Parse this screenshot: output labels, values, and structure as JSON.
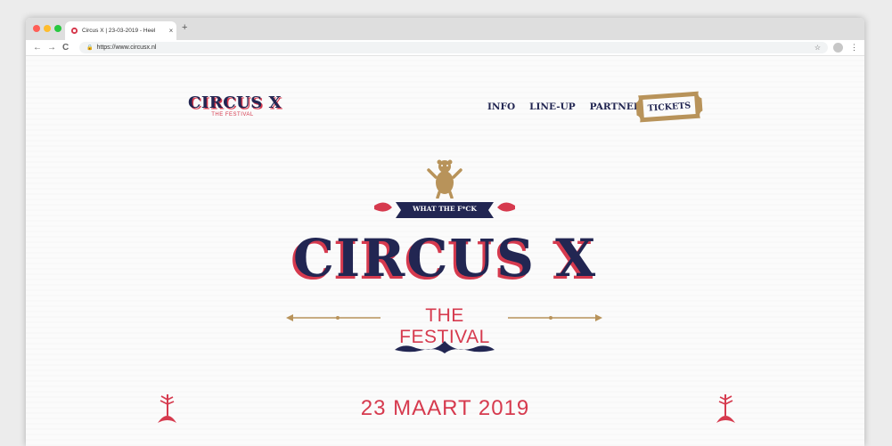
{
  "browser": {
    "tab_title": "Circus X | 23-03-2019 - Heel",
    "new_tab_label": "+",
    "close_label": "×",
    "url": "https://www.circusx.nl",
    "back_label": "←",
    "forward_label": "→",
    "reload_label": "C",
    "bookmark_label": "☆",
    "menu_label": "⋮"
  },
  "header": {
    "logo_text": "CIRCUS X",
    "logo_sub": "THE FESTIVAL",
    "nav": [
      "INFO",
      "LINE-UP",
      "PARTNERS"
    ],
    "tickets_label": "TICKETS"
  },
  "hero": {
    "banner_text": "WHAT THE F*CK",
    "title": "CIRCUS X",
    "subtitle": "THE FESTIVAL",
    "date": "23 MAART 2019"
  },
  "colors": {
    "navy": "#222652",
    "red": "#d63a4e",
    "gold": "#b8935a"
  }
}
